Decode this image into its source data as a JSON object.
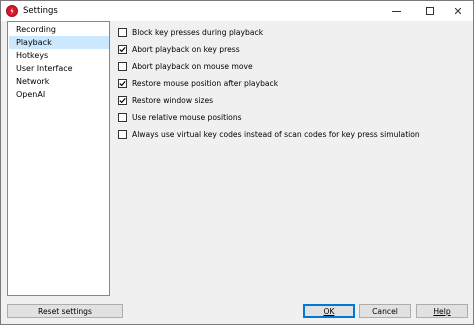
{
  "window": {
    "title": "Settings",
    "icon": "app-logo-icon",
    "controls": [
      "minimize-icon",
      "maximize-icon",
      "close-icon"
    ]
  },
  "sidebar": {
    "items": [
      {
        "label": "Recording",
        "selected": false
      },
      {
        "label": "Playback",
        "selected": true
      },
      {
        "label": "Hotkeys",
        "selected": false
      },
      {
        "label": "User Interface",
        "selected": false
      },
      {
        "label": "Network",
        "selected": false
      },
      {
        "label": "OpenAI",
        "selected": false
      }
    ]
  },
  "playback": {
    "options": [
      {
        "label": "Block key presses during playback",
        "checked": false
      },
      {
        "label": "Abort playback on key press",
        "checked": true
      },
      {
        "label": "Abort playback on mouse move",
        "checked": false
      },
      {
        "label": "Restore mouse position after playback",
        "checked": true
      },
      {
        "label": "Restore window sizes",
        "checked": true
      },
      {
        "label": "Use relative mouse positions",
        "checked": false
      },
      {
        "label": "Always use virtual key codes instead of scan codes for key press simulation",
        "checked": false
      }
    ]
  },
  "buttons": {
    "reset": "Reset settings",
    "ok": "OK",
    "cancel": "Cancel",
    "help": "Help"
  },
  "colors": {
    "selection": "#cce8ff",
    "accent": "#0078d7",
    "app_icon": "#d6192a"
  }
}
